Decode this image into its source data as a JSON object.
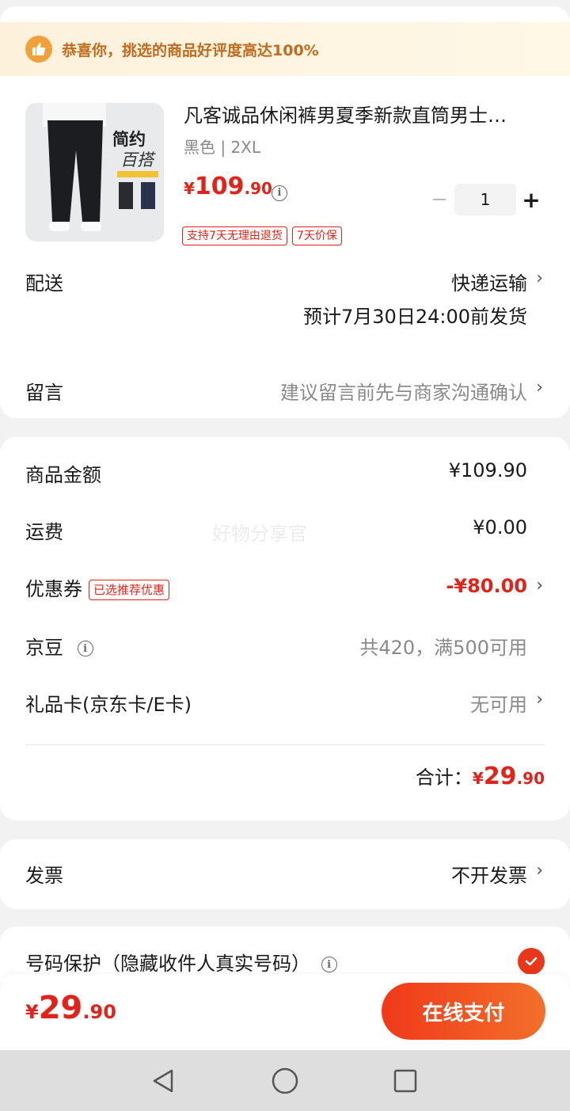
{
  "notice": {
    "text": "恭喜你，挑选的商品好评度高达100%",
    "icon": "thumbs-up-icon"
  },
  "product": {
    "title": "凡客诚品休闲裤男夏季新款直筒男士…",
    "spec": "黑色 | 2XL",
    "price_yen": "¥",
    "price_int": "109",
    "price_dec": ".90",
    "quantity": "1",
    "tags": [
      "支持7天无理由退货",
      "7天价保"
    ],
    "image_text_1": "简约",
    "image_text_2": "百搭"
  },
  "delivery": {
    "label": "配送",
    "value": "快递运输",
    "eta": "预计7月30日24:00前发货"
  },
  "message": {
    "label": "留言",
    "placeholder": "建议留言前先与商家沟通确认"
  },
  "fees": {
    "goods_label": "商品金额",
    "goods_value": "¥109.90",
    "shipping_label": "运费",
    "shipping_value": "¥0.00",
    "coupon_label": "优惠券",
    "coupon_tag": "已选推荐优惠",
    "coupon_value": "-¥80.00",
    "bean_label": "京豆",
    "bean_value": "共420，满500可用",
    "giftcard_label": "礼品卡(京东卡/E卡)",
    "giftcard_value": "无可用",
    "total_label": "合计：",
    "total_yen": "¥",
    "total_int": "29",
    "total_dec": ".90",
    "watermark": "好物分享官"
  },
  "invoice": {
    "label": "发票",
    "value": "不开发票"
  },
  "protection": {
    "label": "号码保护（隐藏收件人真实号码）",
    "checked": true
  },
  "bottom": {
    "price_yen": "¥",
    "price_int": "29",
    "price_dec": ".90",
    "pay_label": "在线支付"
  },
  "colors": {
    "accent": "#e2231a",
    "pay_start": "#f0391a",
    "pay_end": "#f36f2a",
    "notice_text": "#c26a1d"
  }
}
